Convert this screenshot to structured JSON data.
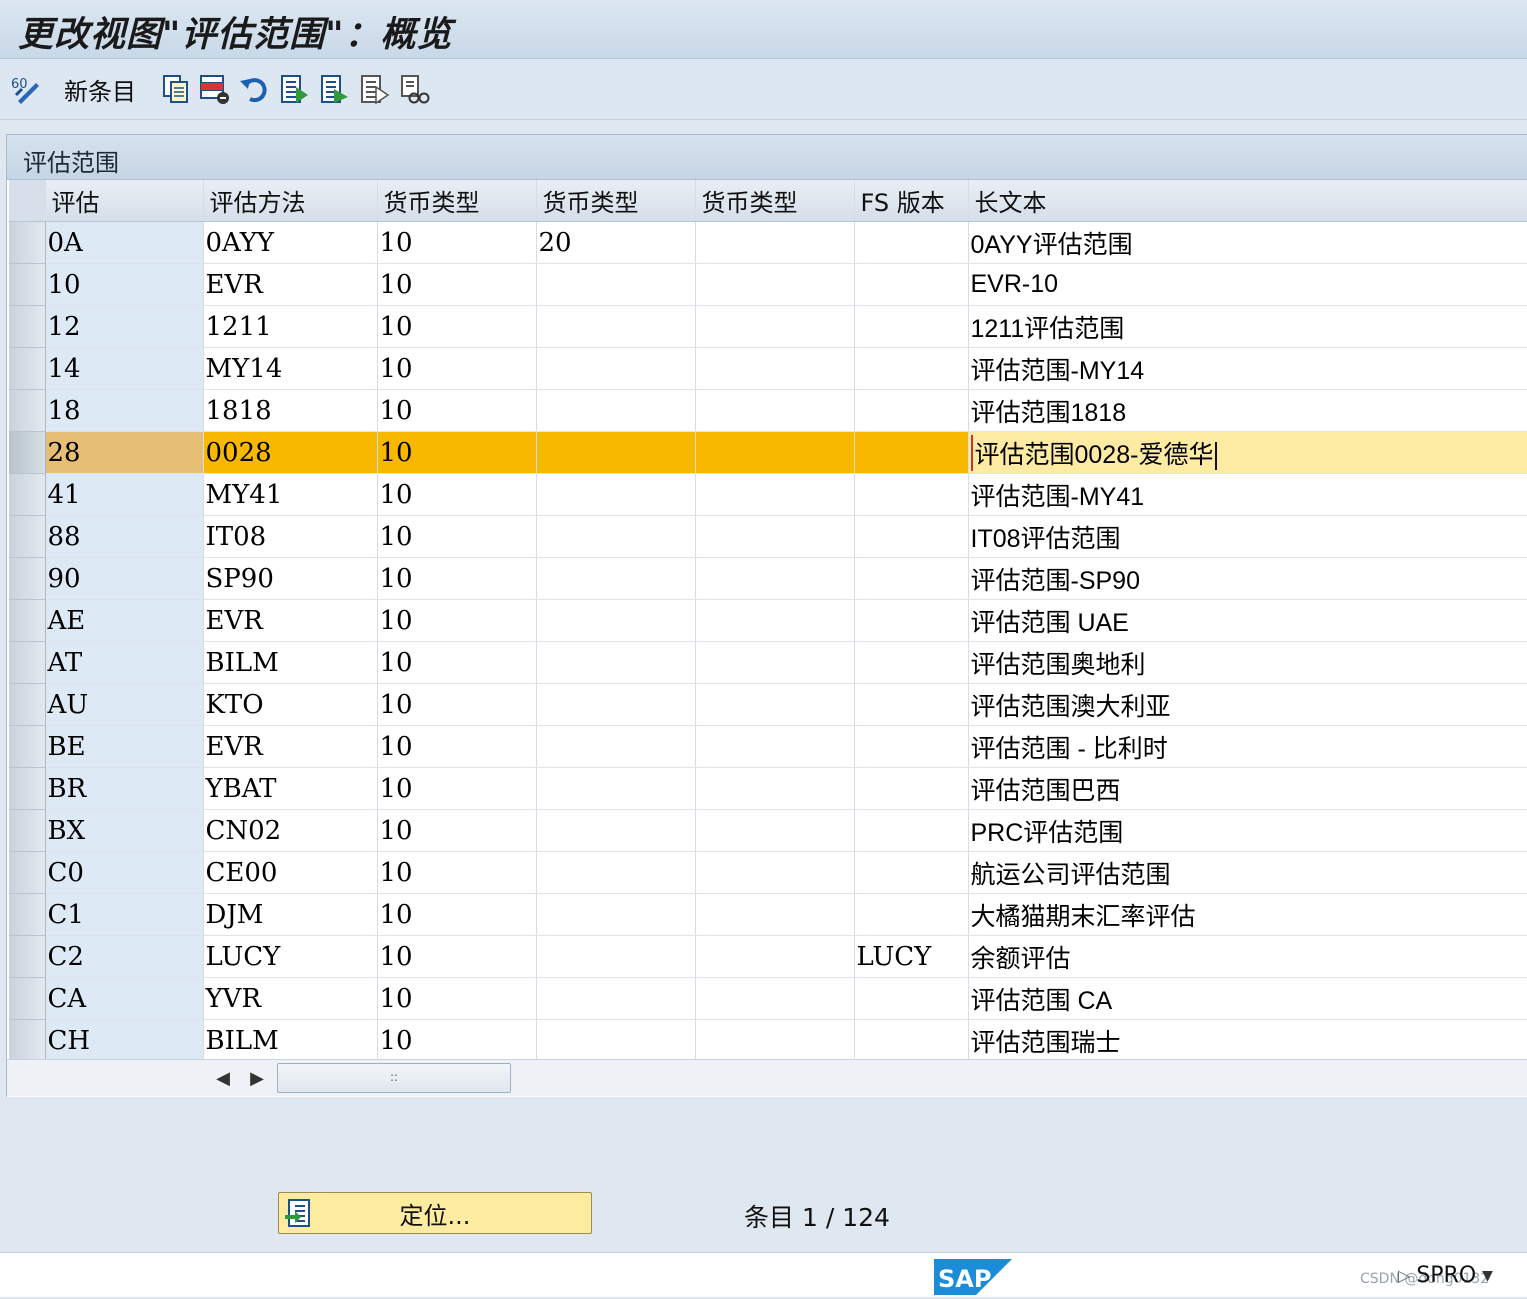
{
  "window": {
    "title": "更改视图\"评估范围\"：概览"
  },
  "toolbar": {
    "new_entries_label": "新条目",
    "icons": [
      "display-change-icon",
      "copy-icon",
      "delete-icon",
      "undo-icon",
      "select-all-icon",
      "select-block-icon",
      "deselect-all-icon",
      "print-icon"
    ]
  },
  "panel": {
    "title": "评估范围"
  },
  "table": {
    "columns": [
      "评估",
      "评估方法",
      "货币类型",
      "货币类型",
      "货币类型",
      "FS 版本",
      "长文本"
    ],
    "rows": [
      [
        "0A",
        "0AYY",
        "10",
        "20",
        "",
        "",
        "0AYY评估范围"
      ],
      [
        "10",
        "EVR",
        "10",
        "",
        "",
        "",
        "EVR-10"
      ],
      [
        "12",
        "1211",
        "10",
        "",
        "",
        "",
        "1211评估范围"
      ],
      [
        "14",
        "MY14",
        "10",
        "",
        "",
        "",
        "评估范围-MY14"
      ],
      [
        "18",
        "1818",
        "10",
        "",
        "",
        "",
        "评估范围1818"
      ],
      [
        "28",
        "0028",
        "10",
        "",
        "",
        "",
        "评估范围0028-爱德华"
      ],
      [
        "41",
        "MY41",
        "10",
        "",
        "",
        "",
        "评估范围-MY41"
      ],
      [
        "88",
        "IT08",
        "10",
        "",
        "",
        "",
        "IT08评估范围"
      ],
      [
        "90",
        "SP90",
        "10",
        "",
        "",
        "",
        "评估范围-SP90"
      ],
      [
        "AE",
        "EVR",
        "10",
        "",
        "",
        "",
        "评估范围 UAE"
      ],
      [
        "AT",
        "BILM",
        "10",
        "",
        "",
        "",
        "评估范围奥地利"
      ],
      [
        "AU",
        "KTO",
        "10",
        "",
        "",
        "",
        "评估范围澳大利亚"
      ],
      [
        "BE",
        "EVR",
        "10",
        "",
        "",
        "",
        "评估范围 - 比利时"
      ],
      [
        "BR",
        "YBAT",
        "10",
        "",
        "",
        "",
        "评估范围巴西"
      ],
      [
        "BX",
        "CN02",
        "10",
        "",
        "",
        "",
        "PRC评估范围"
      ],
      [
        "C0",
        "CE00",
        "10",
        "",
        "",
        "",
        "航运公司评估范围"
      ],
      [
        "C1",
        "DJM",
        "10",
        "",
        "",
        "",
        "大橘猫期末汇率评估"
      ],
      [
        "C2",
        "LUCY",
        "10",
        "",
        "",
        "LUCY",
        "余额评估"
      ],
      [
        "CA",
        "YVR",
        "10",
        "",
        "",
        "",
        "评估范围 CA"
      ],
      [
        "CH",
        "BILM",
        "10",
        "",
        "",
        "",
        "评估范围瑞士"
      ]
    ],
    "highlighted_row": 5
  },
  "scrollbar": {
    "grip": "::"
  },
  "footer": {
    "position_button_label": "定位...",
    "entry_label": "条目",
    "entry_count": "1 / 124"
  },
  "status": {
    "logo_text": "SAP",
    "transaction": "SPRO",
    "watermark": "CSDN @dong0132"
  },
  "colors": {
    "highlight_row": "#f8b800",
    "edit_cell": "#fdeaa3",
    "key_column": "#dde9f5",
    "position_button": "#fdeba0",
    "sap_blue": "#1a8cd8"
  }
}
